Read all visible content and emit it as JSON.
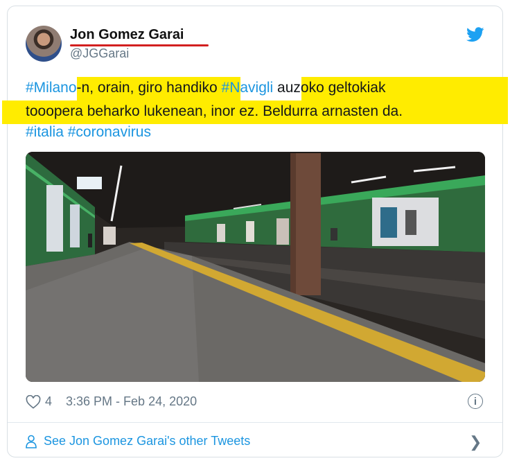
{
  "author": {
    "name": "Jon Gomez Garai",
    "handle": "@JGGarai"
  },
  "tweet": {
    "line1": {
      "tag1": "#Milano",
      "text1": "-n, orain, giro handiko ",
      "tag2": "#Navigli",
      "text2": " auzoko geltokiak"
    },
    "line2": "tooopera beharko lukenean, inor ez. Beldurra arnasten da.",
    "line3": {
      "tag1": "#italia",
      "tag2": "#coronavirus"
    }
  },
  "footer": {
    "likes": "4",
    "timestamp": "3:36 PM - Feb 24, 2020",
    "see_more": "See Jon Gomez Garai's other Tweets"
  },
  "colors": {
    "link": "#1b95e0",
    "highlight": "#ffec00",
    "underline": "#d21f1f"
  },
  "icons": [
    "twitter-bird-icon",
    "heart-icon",
    "info-icon",
    "person-icon",
    "chevron-right-icon"
  ]
}
